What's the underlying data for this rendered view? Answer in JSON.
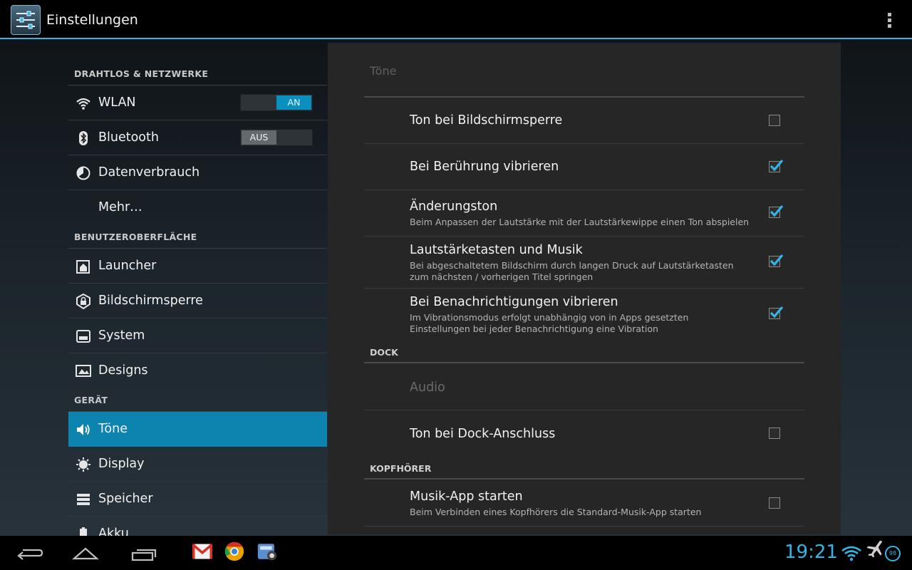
{
  "app": {
    "title": "Einstellungen"
  },
  "nav": {
    "sections": [
      {
        "header": "DRAHTLOS & NETZWERKE"
      },
      {
        "header": "BENUTZEROBERFLÄCHE"
      },
      {
        "header": "GERÄT"
      }
    ],
    "items": [
      {
        "label": "WLAN",
        "toggle": "AN"
      },
      {
        "label": "Bluetooth",
        "toggle": "AUS"
      },
      {
        "label": "Datenverbrauch"
      },
      {
        "label": "Mehr…"
      },
      {
        "label": "Launcher"
      },
      {
        "label": "Bildschirmsperre"
      },
      {
        "label": "System"
      },
      {
        "label": "Designs"
      },
      {
        "label": "Töne"
      },
      {
        "label": "Display"
      },
      {
        "label": "Speicher"
      },
      {
        "label": "Akku"
      }
    ]
  },
  "panel": {
    "title": "Töne",
    "prefs": [
      {
        "title": "Ton bei Bildschirmsperre",
        "checked": false
      },
      {
        "title": "Bei Berührung vibrieren",
        "checked": true
      },
      {
        "title": "Änderungston",
        "summary": "Beim Anpassen der Lautstärke mit der Lautstärkewippe einen Ton abspielen",
        "checked": true
      },
      {
        "title": "Lautstärketasten und Musik",
        "summary": "Bei abgeschaltetem Bildschirm durch langen Druck auf Lautstärketasten zum nächsten / vorherigen Titel springen",
        "checked": true
      },
      {
        "title": "Bei Benachrichtigungen vibrieren",
        "summary": "Im Vibrationsmodus erfolgt unabhängig von in Apps gesetzten Einstellungen bei jeder Benachrichtigung eine Vibration",
        "checked": true
      }
    ],
    "dock": {
      "header": "DOCK",
      "audio_label": "Audio",
      "pref": {
        "title": "Ton bei Dock-Anschluss",
        "checked": false
      }
    },
    "headphones": {
      "header": "KOPFHÖRER",
      "pref": {
        "title": "Musik-App starten",
        "summary": "Beim Verbinden eines Kopfhörers die Standard-Musik-App starten",
        "checked": false
      }
    }
  },
  "systembar": {
    "clock": "19:21",
    "battery": "98"
  },
  "colors": {
    "accent": "#33b5e5",
    "selected": "#0d84b0",
    "toggle_on": "#0a8fbf"
  },
  "icons": [
    "settings-app-icon",
    "overflow-menu-icon",
    "wifi-icon",
    "bluetooth-icon",
    "data-usage-icon",
    "launcher-icon",
    "lock-icon",
    "system-icon",
    "designs-icon",
    "sound-icon",
    "display-icon",
    "storage-icon",
    "battery-icon",
    "back-icon",
    "home-icon",
    "recents-icon",
    "gmail-icon",
    "chrome-icon",
    "app-icon",
    "airplane-icon",
    "battery-status-icon"
  ]
}
